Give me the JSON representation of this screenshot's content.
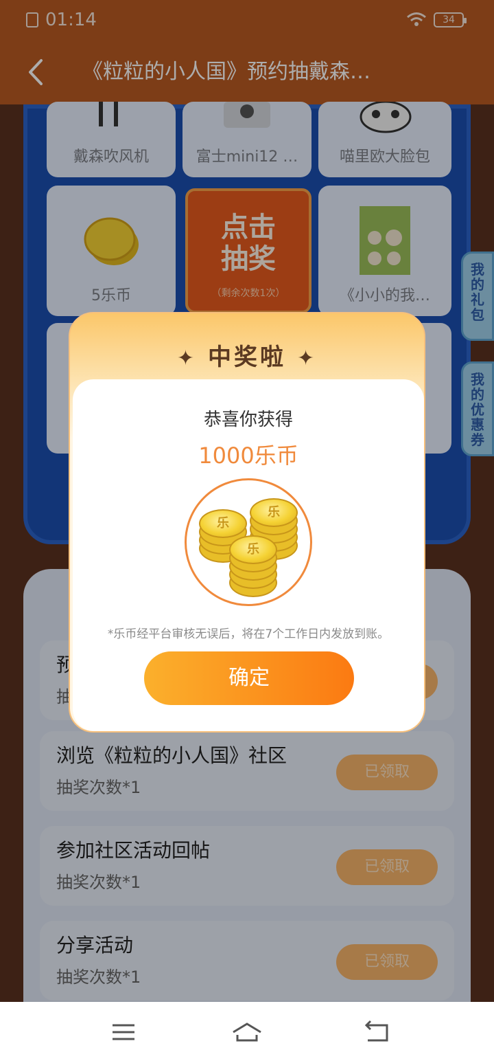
{
  "status": {
    "time": "01:14",
    "battery": "34"
  },
  "header": {
    "title": "《粒粒的小人国》预约抽戴森…"
  },
  "grid": {
    "items": [
      {
        "label": "戴森吹风机",
        "icon": "hair-dryer-icon"
      },
      {
        "label": "富士mini12 …",
        "icon": "instant-camera-icon"
      },
      {
        "label": "喵里欧大脸包",
        "icon": "cat-bag-icon"
      },
      {
        "label": "5乐币",
        "icon": "coin-icon"
      },
      {
        "label": "《小小的我…",
        "icon": "sticker-icon"
      }
    ],
    "draw_button": {
      "line1": "点击",
      "line2": "抽奖",
      "remaining": "（剩余次数1次）"
    }
  },
  "side_tabs": {
    "gifts": "我的礼包",
    "coupons": "我的优惠券"
  },
  "tasks": [
    {
      "title": "预",
      "sub": "抽",
      "button": ""
    },
    {
      "title": "浏览《粒粒的小人国》社区",
      "sub": "抽奖次数*1",
      "button": "已领取"
    },
    {
      "title": "参加社区活动回帖",
      "sub": "抽奖次数*1",
      "button": "已领取"
    },
    {
      "title": "分享活动",
      "sub": "抽奖次数*1",
      "button": "已领取"
    }
  ],
  "modal": {
    "heading": "中奖啦",
    "congrats": "恭喜你获得",
    "prize": "1000乐币",
    "note": "*乐币经平台审核无误后，将在7个工作日内发放到账。",
    "confirm": "确定"
  },
  "colors": {
    "accent": "#f08a3c",
    "header": "#b85a22",
    "button": "#fb7a12"
  }
}
